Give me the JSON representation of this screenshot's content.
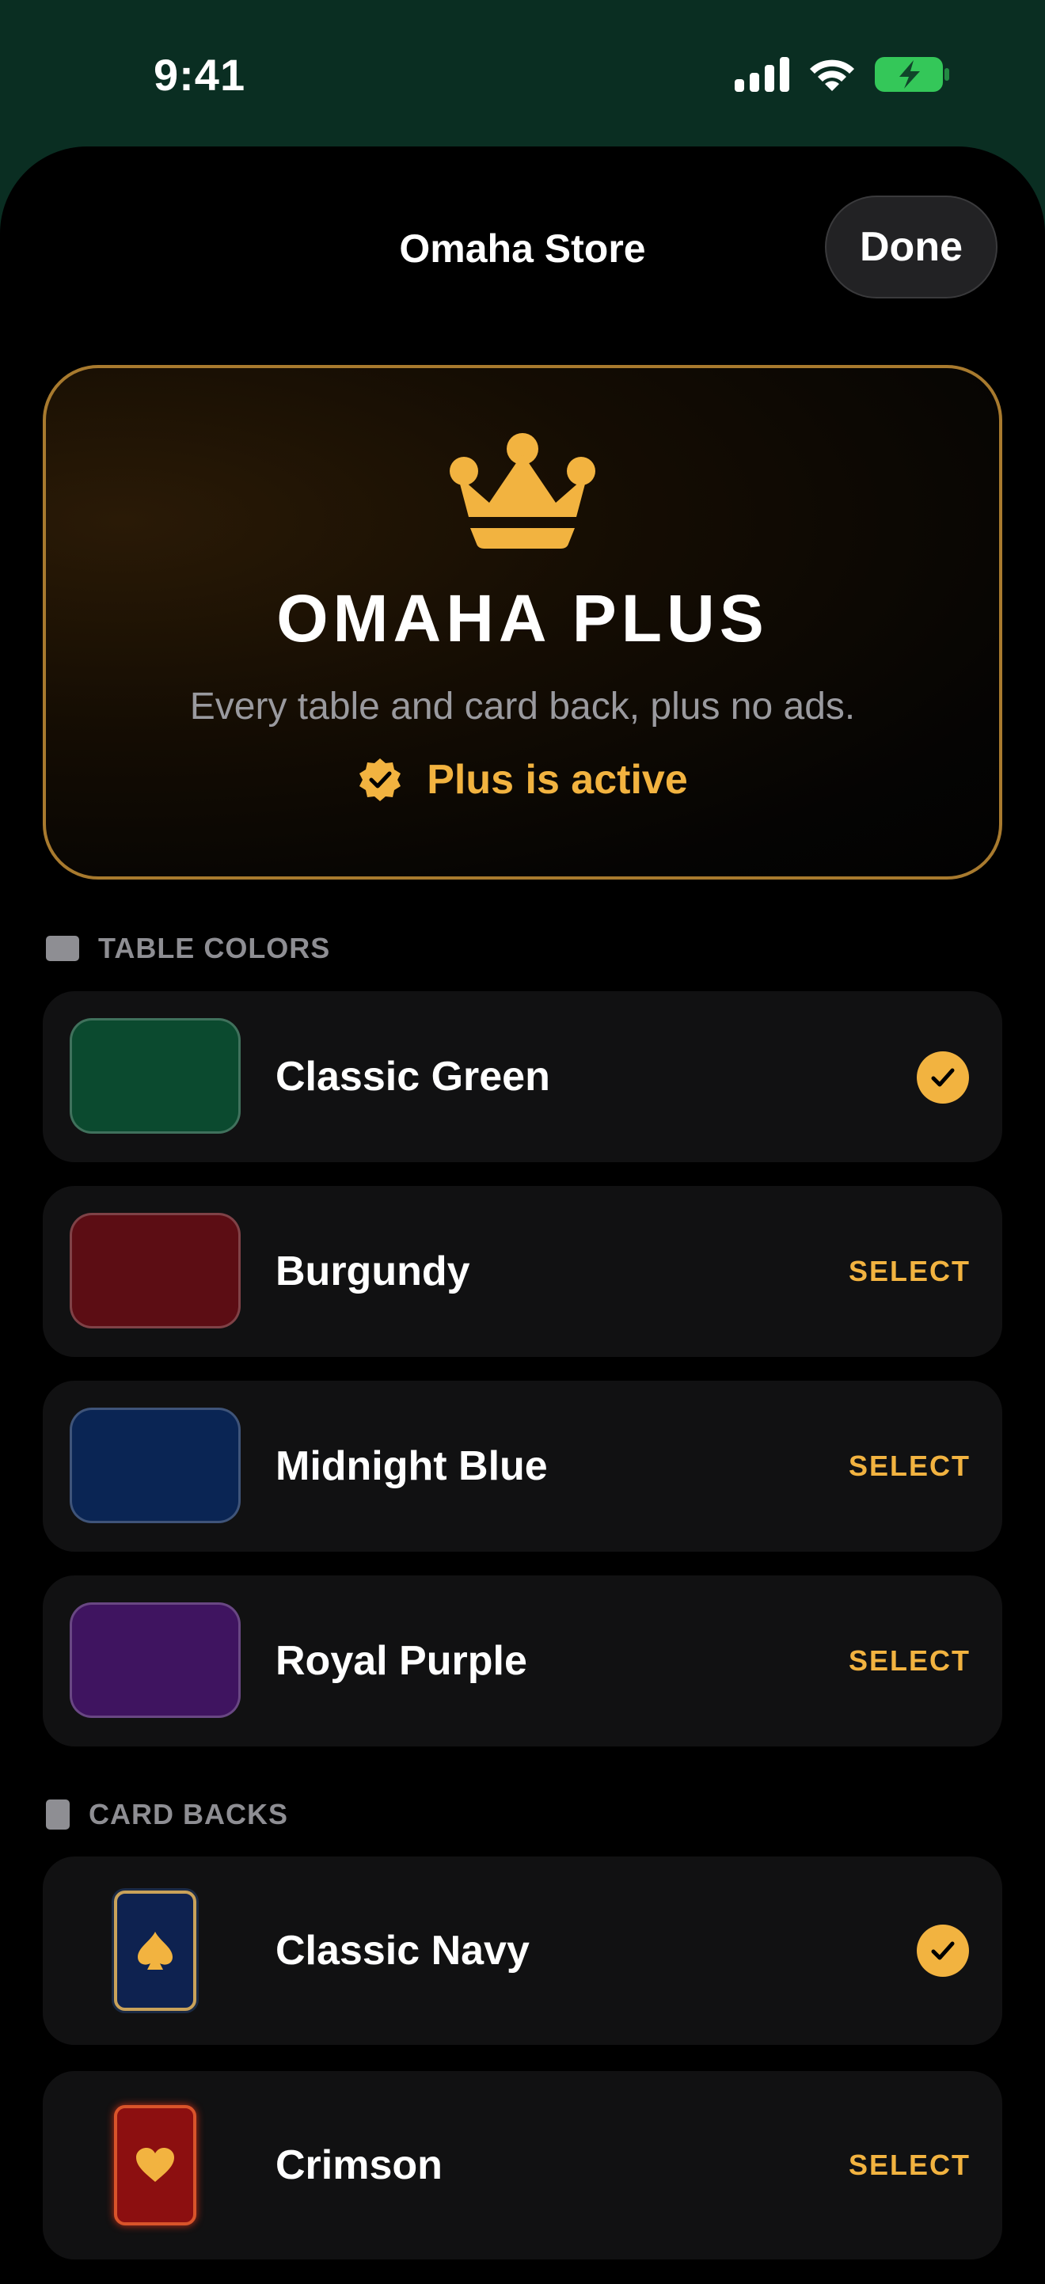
{
  "status": {
    "time": "9:41"
  },
  "nav": {
    "title": "Omaha Store",
    "done_label": "Done"
  },
  "plus": {
    "title": "OMAHA PLUS",
    "subtitle": "Every table and card back, plus no ads.",
    "status": "Plus is active"
  },
  "table_colors": {
    "header": "TABLE COLORS",
    "items": [
      {
        "label": "Classic Green",
        "color": "#0b4a2f",
        "selected": true,
        "action": ""
      },
      {
        "label": "Burgundy",
        "color": "#5c0d14",
        "selected": false,
        "action": "SELECT"
      },
      {
        "label": "Midnight Blue",
        "color": "#0a2554",
        "selected": false,
        "action": "SELECT"
      },
      {
        "label": "Royal Purple",
        "color": "#3f1460",
        "selected": false,
        "action": "SELECT"
      }
    ]
  },
  "card_backs": {
    "header": "CARD BACKS",
    "items": [
      {
        "label": "Classic Navy",
        "icon": "spade-icon",
        "selected": true,
        "action": ""
      },
      {
        "label": "Crimson",
        "icon": "heart-icon",
        "selected": false,
        "action": "SELECT"
      }
    ]
  },
  "colors": {
    "accent": "#f2b340",
    "background": "#000000",
    "row": "#111112"
  }
}
